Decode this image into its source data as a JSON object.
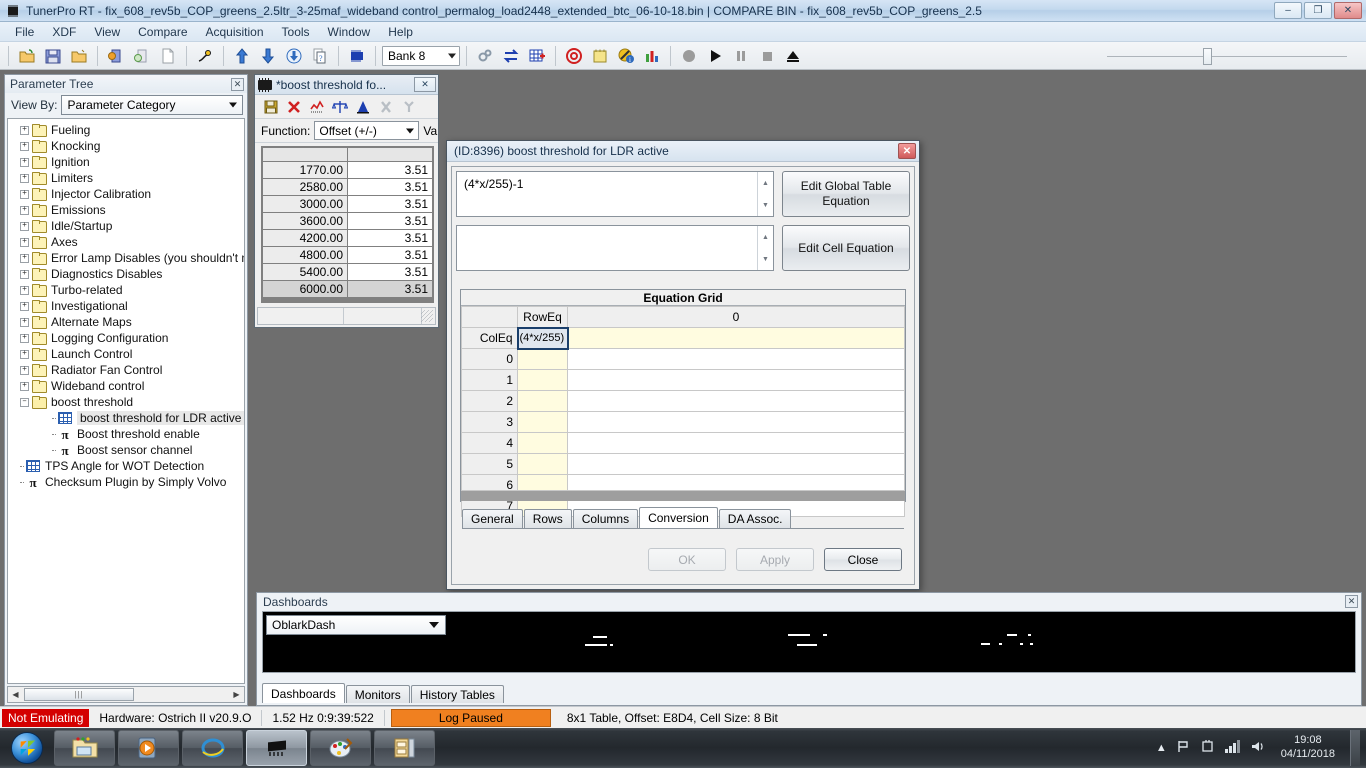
{
  "window": {
    "title": "TunerPro RT - fix_608_rev5b_COP_greens_2.5ltr_3-25maf_wideband control_permalog_load2448_extended_btc_06-10-18.bin | COMPARE BIN - fix_608_rev5b_COP_greens_2.5",
    "minimize": "–",
    "maximize": "❐",
    "close": "✕",
    "icon": "chip-icon"
  },
  "menubar": {
    "items": [
      "File",
      "XDF",
      "View",
      "Compare",
      "Acquisition",
      "Tools",
      "Window",
      "Help"
    ]
  },
  "toolbar": {
    "bank_value": "Bank 8",
    "icons": [
      "open-folder-icon",
      "save-icon",
      "open-bin-icon",
      "compare-bin-icon",
      "close-compare-icon",
      "new-file-icon",
      "hardware-icon",
      "upload-icon",
      "download-icon",
      "download-all-icon",
      "copy-icon",
      "emulator-chip-icon",
      "settings-icon",
      "swap-icon",
      "table-grid-icon",
      "record-target-icon",
      "notes-icon",
      "no-info-icon",
      "chart-icon",
      "record-icon",
      "play-icon",
      "pause-icon",
      "stop-icon",
      "eject-icon"
    ]
  },
  "parameter_tree": {
    "title": "Parameter Tree",
    "close_glyph": "✕",
    "view_by_label": "View By:",
    "view_by_value": "Parameter Category",
    "nodes": [
      {
        "label": "Fueling",
        "type": "folder",
        "level": 1,
        "expander": "+"
      },
      {
        "label": "Knocking",
        "type": "folder",
        "level": 1,
        "expander": "+"
      },
      {
        "label": "Ignition",
        "type": "folder",
        "level": 1,
        "expander": "+"
      },
      {
        "label": "Limiters",
        "type": "folder",
        "level": 1,
        "expander": "+"
      },
      {
        "label": "Injector Calibration",
        "type": "folder",
        "level": 1,
        "expander": "+"
      },
      {
        "label": "Emissions",
        "type": "folder",
        "level": 1,
        "expander": "+"
      },
      {
        "label": "Idle/Startup",
        "type": "folder",
        "level": 1,
        "expander": "+"
      },
      {
        "label": "Axes",
        "type": "folder",
        "level": 1,
        "expander": "+"
      },
      {
        "label": "Error Lamp Disables (you shouldn't need",
        "type": "folder",
        "level": 1,
        "expander": "+"
      },
      {
        "label": "Diagnostics Disables",
        "type": "folder",
        "level": 1,
        "expander": "+"
      },
      {
        "label": "Turbo-related",
        "type": "folder",
        "level": 1,
        "expander": "+"
      },
      {
        "label": "Investigational",
        "type": "folder",
        "level": 1,
        "expander": "+"
      },
      {
        "label": "Alternate Maps",
        "type": "folder",
        "level": 1,
        "expander": "+"
      },
      {
        "label": "Logging Configuration",
        "type": "folder",
        "level": 1,
        "expander": "+"
      },
      {
        "label": "Launch Control",
        "type": "folder",
        "level": 1,
        "expander": "+"
      },
      {
        "label": "Radiator Fan Control",
        "type": "folder",
        "level": 1,
        "expander": "+"
      },
      {
        "label": "Wideband control",
        "type": "folder",
        "level": 1,
        "expander": "+"
      },
      {
        "label": "boost threshold",
        "type": "folder-open",
        "level": 1,
        "expander": "–"
      },
      {
        "label": "boost threshold for LDR active",
        "type": "table",
        "level": 2,
        "selected": true
      },
      {
        "label": "Boost threshold enable",
        "type": "constant",
        "level": 2
      },
      {
        "label": "Boost sensor channel",
        "type": "constant",
        "level": 2
      },
      {
        "label": "TPS Angle for WOT Detection",
        "type": "table",
        "level": 1
      },
      {
        "label": "Checksum Plugin by Simply Volvo",
        "type": "constant",
        "level": 1
      }
    ]
  },
  "table_window": {
    "title": "*boost threshold fo...",
    "close_glyph": "✕",
    "toolbar_icons": [
      "save-icon",
      "close-red-x-icon",
      "graph-icon",
      "scales-icon",
      "compare-icon",
      "x-axis-icon",
      "y-axis-icon"
    ],
    "function_label": "Function:",
    "function_value": "Offset (+/-)",
    "value_label": "Va",
    "rows": [
      {
        "axis": "1770.00",
        "value": "3.51"
      },
      {
        "axis": "2580.00",
        "value": "3.51"
      },
      {
        "axis": "3000.00",
        "value": "3.51"
      },
      {
        "axis": "3600.00",
        "value": "3.51"
      },
      {
        "axis": "4200.00",
        "value": "3.51"
      },
      {
        "axis": "4800.00",
        "value": "3.51"
      },
      {
        "axis": "5400.00",
        "value": "3.51"
      },
      {
        "axis": "6000.00",
        "value": "3.51"
      }
    ]
  },
  "dialog": {
    "title": "(ID:8396) boost threshold for LDR active",
    "close_glyph": "✕",
    "global_equation": "(4*x/255)-1",
    "cell_equation": "",
    "edit_global_button": "Edit Global Table Equation",
    "edit_cell_button": "Edit Cell Equation",
    "equation_grid": {
      "title": "Equation Grid",
      "roweq_header": "RowEq",
      "coleq_header": "ColEq",
      "column_headers": [
        "0"
      ],
      "selected_cell_value": "(4*x/255)",
      "row_indices": [
        "0",
        "1",
        "2",
        "3",
        "4",
        "5",
        "6",
        "7"
      ]
    },
    "tabs": [
      {
        "label": "General",
        "active": false
      },
      {
        "label": "Rows",
        "active": false
      },
      {
        "label": "Columns",
        "active": false
      },
      {
        "label": "Conversion",
        "active": true
      },
      {
        "label": "DA Assoc.",
        "active": false
      }
    ],
    "buttons": [
      {
        "label": "OK",
        "enabled": false
      },
      {
        "label": "Apply",
        "enabled": false
      },
      {
        "label": "Close",
        "enabled": true
      }
    ]
  },
  "dashboards": {
    "title": "Dashboards",
    "close_glyph": "✕",
    "selected_dash": "OblarkDash",
    "tabs": [
      {
        "label": "Dashboards",
        "active": true
      },
      {
        "label": "Monitors",
        "active": false
      },
      {
        "label": "History Tables",
        "active": false
      }
    ]
  },
  "statusbar": {
    "emulating": "Not Emulating",
    "hardware": "Hardware: Ostrich II v20.9.O",
    "rate": "1.52 Hz  0:9:39:522",
    "log_state": "Log Paused",
    "table_info": "8x1 Table, Offset: E8D4,  Cell Size: 8 Bit"
  },
  "taskbar": {
    "start": "start-orb-icon",
    "items": [
      "file-explorer-icon",
      "media-player-icon",
      "internet-explorer-icon",
      "tunerpro-chip-icon",
      "paint-icon",
      "archive-icon"
    ],
    "tray_icons": [
      "show-hidden-icon",
      "flag-action-center-icon",
      "network-plug-icon",
      "signal-bars-icon",
      "volume-icon"
    ],
    "time": "19:08",
    "date": "04/11/2018"
  },
  "colors": {
    "accent": "#2b5fb0",
    "alert_red": "#d40000",
    "log_orange": "#f08020",
    "equation_cell": "#fffce0"
  }
}
